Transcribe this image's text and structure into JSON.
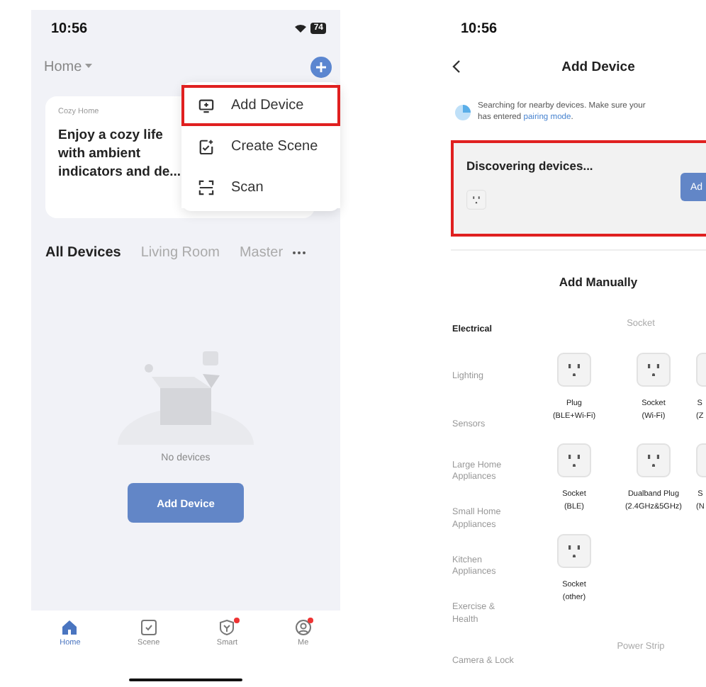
{
  "home_screen": {
    "status_bar": {
      "time": "10:56",
      "battery": "74"
    },
    "home_selector": "Home",
    "home_card": {
      "label": "Cozy Home",
      "text": "Enjoy a cozy life with ambient indicators and de..."
    },
    "menu": [
      {
        "kind": "add",
        "label": "Add Device",
        "highlighted": true
      },
      {
        "kind": "scene",
        "label": "Create Scene",
        "highlighted": false
      },
      {
        "kind": "scan",
        "label": "Scan",
        "highlighted": false
      }
    ],
    "room_tabs": [
      {
        "label": "All Devices",
        "selected": true
      },
      {
        "label": "Living Room",
        "selected": false
      },
      {
        "label": "Master",
        "selected": false
      }
    ],
    "empty_state": {
      "message": "No devices",
      "button": "Add Device"
    },
    "tab_bar": [
      {
        "kind": "home",
        "label": "Home",
        "selected": true,
        "badge": false
      },
      {
        "kind": "scene",
        "label": "Scene",
        "selected": false,
        "badge": false
      },
      {
        "kind": "smart",
        "label": "Smart",
        "selected": false,
        "badge": true
      },
      {
        "kind": "me",
        "label": "Me",
        "selected": false,
        "badge": true
      }
    ]
  },
  "add_device_screen": {
    "status_bar": {
      "time": "10:56"
    },
    "title": "Add Device",
    "search_notice": {
      "text": "Searching for nearby devices. Make sure your",
      "link_prefix": "has entered ",
      "link": "pairing mode",
      "link_suffix": "."
    },
    "discovery": {
      "title": "Discovering devices...",
      "button": "Ad",
      "highlighted": true
    },
    "section_title": "Add Manually",
    "categories": [
      {
        "label": "Electrical",
        "selected": true
      },
      {
        "label": "Lighting",
        "selected": false
      },
      {
        "label": "Sensors",
        "selected": false
      },
      {
        "label": "Large Home Appliances",
        "selected": false
      },
      {
        "label": "Small Home Appliances",
        "selected": false
      },
      {
        "label": "Kitchen Appliances",
        "selected": false
      },
      {
        "label": "Exercise & Health",
        "selected": false
      },
      {
        "label": "Camera & Lock",
        "selected": false
      }
    ],
    "groups": [
      {
        "title": "Socket",
        "devices": [
          {
            "lines": [
              "Plug",
              "(BLE+Wi-Fi)"
            ],
            "clipped": false
          },
          {
            "lines": [
              "Socket",
              "(Wi-Fi)"
            ],
            "clipped": false
          },
          {
            "lines": [
              "S",
              "(Z"
            ],
            "clipped": true
          },
          {
            "lines": [
              "Socket",
              "(BLE)"
            ],
            "clipped": false
          },
          {
            "lines": [
              "Dualband Plug",
              "(2.4GHz&5GHz)"
            ],
            "clipped": false
          },
          {
            "lines": [
              "S",
              "(N"
            ],
            "clipped": true
          },
          {
            "lines": [
              "Socket",
              "(other)"
            ],
            "clipped": false
          }
        ]
      },
      {
        "title": "Power Strip"
      }
    ]
  }
}
